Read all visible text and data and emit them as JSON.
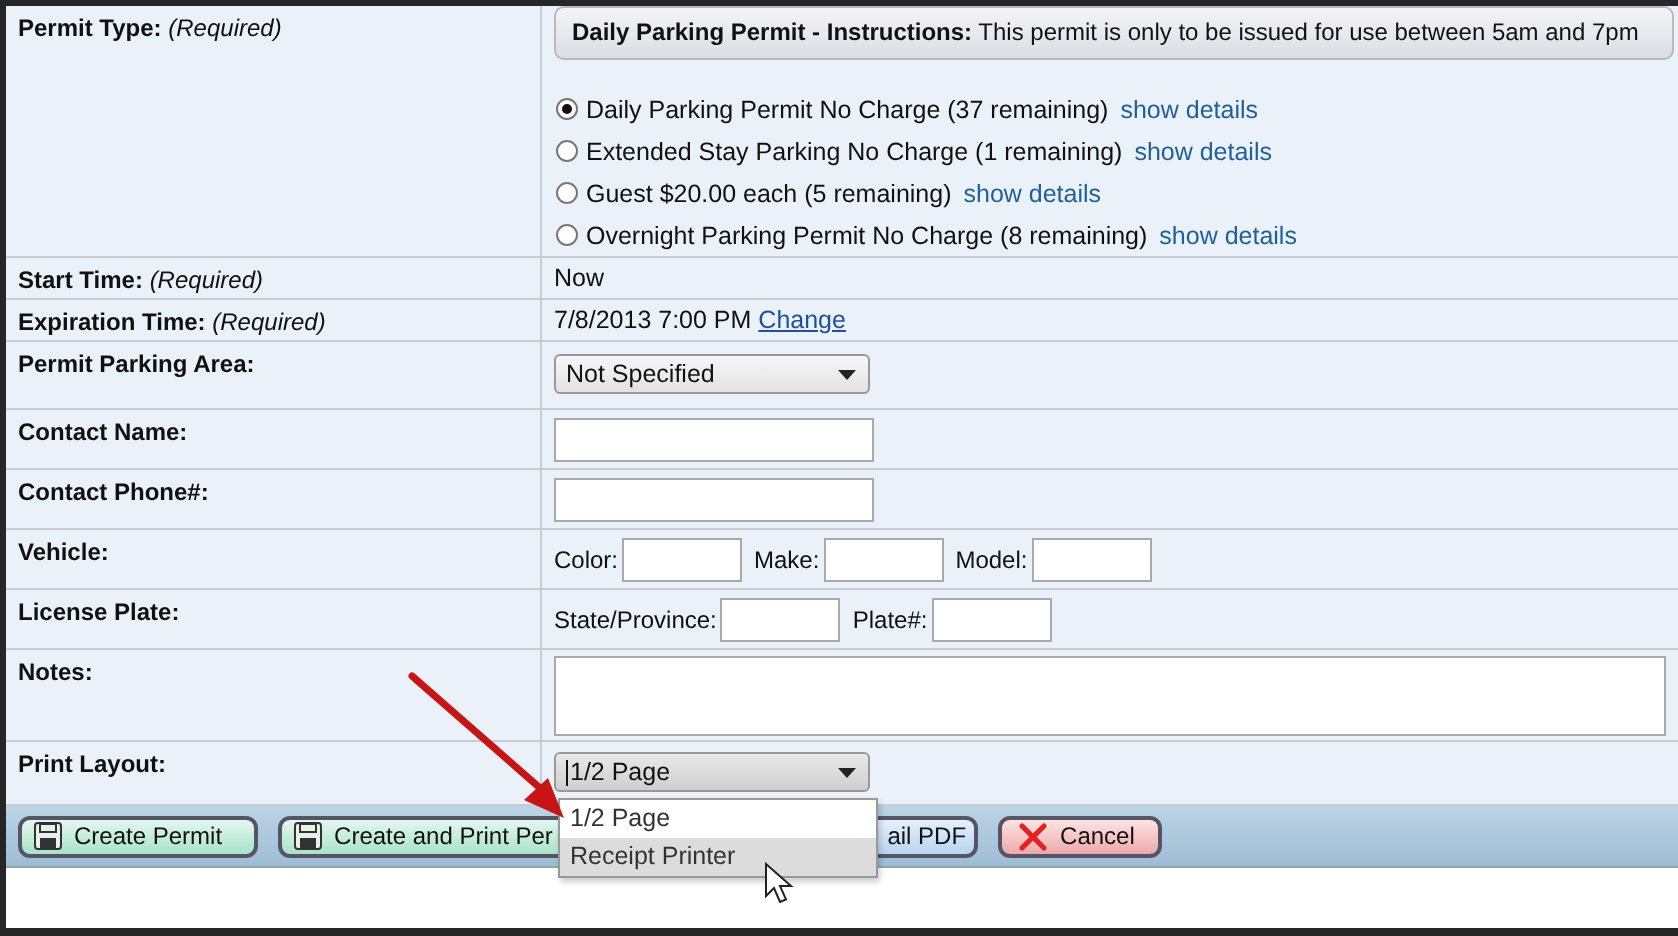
{
  "form": {
    "rows": [
      {
        "label": "**Permit Type:** *(Required)*",
        "kind": "radios",
        "instructions": "**Daily Parking Permit - Instructions:** This permit is only to be issued for use between 5am and 7pm",
        "options": [
          {
            "label": "Daily Parking Permit No Charge (37 remaining)",
            "link": "show details",
            "selected": true
          },
          {
            "label": "Extended Stay Parking No Charge (1 remaining)",
            "link": "show details",
            "selected": false
          },
          {
            "label": "Guest $20.00 each (5 remaining)",
            "link": "show details",
            "selected": false
          },
          {
            "label": "Overnight Parking Permit No Charge (8 remaining)",
            "link": "show details",
            "selected": false
          }
        ]
      },
      {
        "label": "**Start Time:** *(Required)*",
        "kind": "text",
        "value": "Now"
      },
      {
        "label": "**Expiration Time:** *(Required)*",
        "kind": "text",
        "value": "7/8/2013 7:00 PM",
        "link": "Change"
      },
      {
        "label": "Permit Parking Area:",
        "kind": "select",
        "value": "Not Specified"
      },
      {
        "label": "Contact Name:",
        "kind": "input"
      },
      {
        "label": "Contact Phone#:",
        "kind": "input"
      },
      {
        "label": "Vehicle:",
        "kind": "inline_inputs",
        "fields": [
          {
            "label": "Color:"
          },
          {
            "label": "Make:"
          },
          {
            "label": "Model:"
          }
        ]
      },
      {
        "label": "License Plate:",
        "kind": "inline_inputs",
        "fields": [
          {
            "label": "State/Province:"
          },
          {
            "label": "Plate#:"
          }
        ]
      },
      {
        "label": "Notes:",
        "kind": "textarea"
      },
      {
        "label": "Print Layout:",
        "kind": "select_open",
        "value": "1/2 Page",
        "options": [
          {
            "label": "1/2 Page",
            "highlighted": false
          },
          {
            "label": "Receipt Printer",
            "highlighted": true
          }
        ]
      }
    ]
  },
  "buttons": [
    {
      "label": "Create Permit",
      "kind": "save"
    },
    {
      "label": "Create and Print Per",
      "kind": "save_cut"
    },
    {
      "label": "ail PDF",
      "kind": "cut_left"
    },
    {
      "label": "Cancel",
      "kind": "cancel"
    }
  ]
}
